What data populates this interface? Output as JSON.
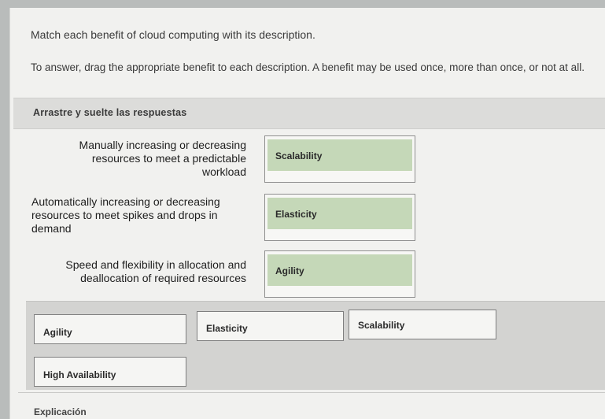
{
  "question": {
    "text": "Match each benefit of cloud computing with its description.",
    "instructions": "To answer, drag the appropriate benefit to each description. A benefit may be used once, more than once, or not at all."
  },
  "drag_area": {
    "header": "Arrastre y suelte las respuestas"
  },
  "descriptions": [
    {
      "text": "Manually increasing or decreasing resources to meet a predictable workload",
      "answer": "Scalability"
    },
    {
      "text": "Automatically increasing or decreasing resources to meet spikes and drops in demand",
      "answer": "Elasticity"
    },
    {
      "text": "Speed and flexibility in allocation and deallocation of required resources",
      "answer": "Agility"
    }
  ],
  "options": [
    "Agility",
    "Elasticity",
    "Scalability",
    "High Availability"
  ],
  "footer": {
    "explanation_label": "Explicación"
  },
  "colors": {
    "answer_chip": "#c5d8b8",
    "header_bar": "#dcdcda",
    "options_pool": "#d3d3d1"
  }
}
